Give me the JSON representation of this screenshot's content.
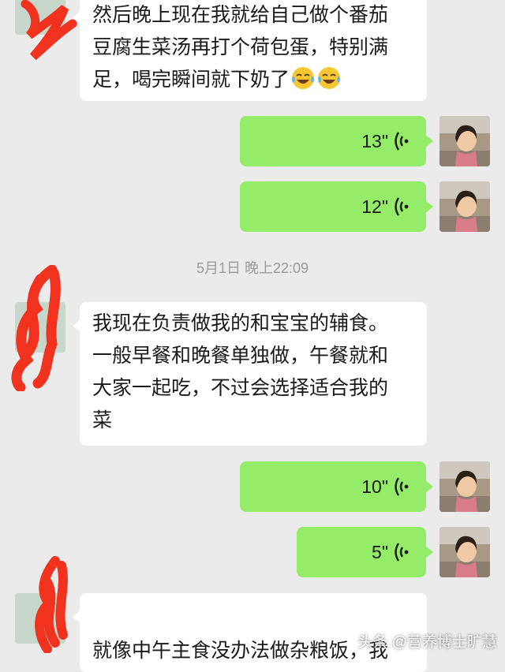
{
  "chat": {
    "messages": [
      {
        "side": "left",
        "type": "text",
        "lines": [
          "然后晚上现在我就给自己做个番茄",
          "豆腐生菜汤再打个荷包蛋，特别满",
          "足，喝完瞬间就下奶了"
        ],
        "emojis": [
          "laugh-cry-emoji",
          "laugh-cry-emoji"
        ]
      },
      {
        "side": "right",
        "type": "voice",
        "duration": "13\""
      },
      {
        "side": "right",
        "type": "voice",
        "duration": "12\""
      },
      {
        "type": "timestamp",
        "text": "5月1日 晚上22:09"
      },
      {
        "side": "left",
        "type": "text",
        "lines": [
          "我现在负责做我的和宝宝的辅食。",
          "一般早餐和晚餐单独做，午餐就和",
          "大家一起吃，不过会选择适合我的",
          "菜"
        ]
      },
      {
        "side": "right",
        "type": "voice",
        "duration": "10\""
      },
      {
        "side": "right",
        "type": "voice",
        "duration": "5\""
      },
      {
        "side": "left",
        "type": "text",
        "lines": [
          "就像中午主食没办法做杂粮饭，我"
        ]
      }
    ]
  },
  "watermark": "头条 @营养博士旷慧",
  "colors": {
    "background": "#ebebeb",
    "sent_bubble": "#95ec69",
    "received_bubble": "#ffffff",
    "redaction_scribble": "#f0321e"
  }
}
